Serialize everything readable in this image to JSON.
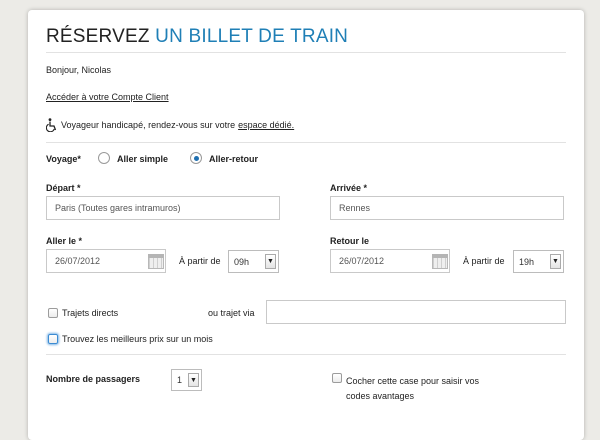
{
  "header": {
    "title_part1": "RÉSERVEZ",
    "title_part2": "UN BILLET DE TRAIN",
    "accent_color": "#1f7fb6"
  },
  "greeting": "Bonjour, Nicolas",
  "account_link": "Accéder à votre Compte Client",
  "accessibility": {
    "icon": "wheelchair-icon",
    "text": "Voyageur handicapé, rendez-vous sur votre",
    "link": "espace dédié."
  },
  "voyage": {
    "label": "Voyage*",
    "options": [
      "Aller simple",
      "Aller-retour"
    ],
    "selected": "Aller-retour"
  },
  "depart": {
    "label": "Départ *",
    "value": "Paris (Toutes gares intramuros)"
  },
  "arrivee": {
    "label": "Arrivée *",
    "value": "Rennes"
  },
  "aller": {
    "label": "Aller le *",
    "date": "26/07/2012",
    "from_label": "À partir de",
    "hour": "09h"
  },
  "retour": {
    "label": "Retour le",
    "date": "26/07/2012",
    "from_label": "À partir de",
    "hour": "19h"
  },
  "options": {
    "direct_label": "Trajets directs",
    "via_label": "ou trajet via",
    "via_value": "",
    "best_price_label": "Trouvez les meilleurs prix sur un mois"
  },
  "passengers": {
    "label": "Nombre de passagers",
    "value": "1",
    "promo_label_line1": "Cocher cette case pour saisir vos",
    "promo_label_line2": "codes avantages"
  },
  "arrow_glyph": "▼"
}
